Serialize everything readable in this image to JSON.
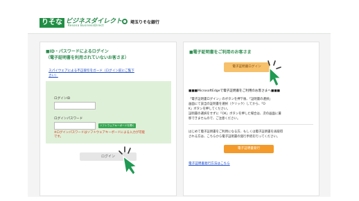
{
  "header": {
    "logo_main": "りそな",
    "logo_sub": "ビジネスダイレクト",
    "logo_sub2": "Resona BusinessDirect",
    "bank_name": "埼玉りそな銀行"
  },
  "left_panel": {
    "title_line1": "■ID・パスワードによるログイン",
    "title_line2": "（電子証明書を利用されていないお客さま）",
    "spyware_link_line1": "スパイウェアによる不正取引をガード（ログイン前にご覧下",
    "spyware_link_line2": "さい）",
    "login_id_label": "ログインID",
    "login_id_value": "",
    "password_label": "ログインパスワード",
    "password_value": "",
    "software_keyboard_label": "ソフトウェアキーボードを開く",
    "warning_line1": "※ログインパスワードはソフトウェアキーボードによる入力が可能",
    "warning_line2": "です。",
    "login_button": "ログイン"
  },
  "right_panel": {
    "title": "■電子証明書をご利用のお客さま",
    "cert_login_button": "電子証明書ログイン",
    "edge_heading": "■■■MicrosoftEdgeで電子証明書をご利用のお客さまへ■■■",
    "edge_text_line1": "「電子証明書ログイン」のボタンを押下後、「証明書の選択」",
    "edge_text_line2": "画面にて該当の証明書を選択（クリック）してから、「O",
    "edge_text_line3": "K」ボタンを押してください。",
    "edge_text_line4": "証明書の選択をせずに「OK」ボタンを押した場合は、次の画面に遷",
    "edge_text_line5": "移できませんので、ご注意ください。",
    "issue_text_line1": "はじめて電子証明書をご利用になる方、もしくは電子証明書を再取得",
    "issue_text_line2": "される方は、こちらから電子証明書の発行手続を行ってください。",
    "issue_button": "電子証明書発行",
    "issue_link": "電子証明書発行方法はこちら"
  },
  "colors": {
    "brand_green": "#2b8c4e",
    "orange": "#f39a2a",
    "orange_light": "#f7c06a",
    "cursor_green": "#1f9a52"
  },
  "icons": [
    "resona-logo-icon",
    "saitama-bank-mark-icon",
    "pointer-cursor-icon",
    "click-burst-icon"
  ]
}
